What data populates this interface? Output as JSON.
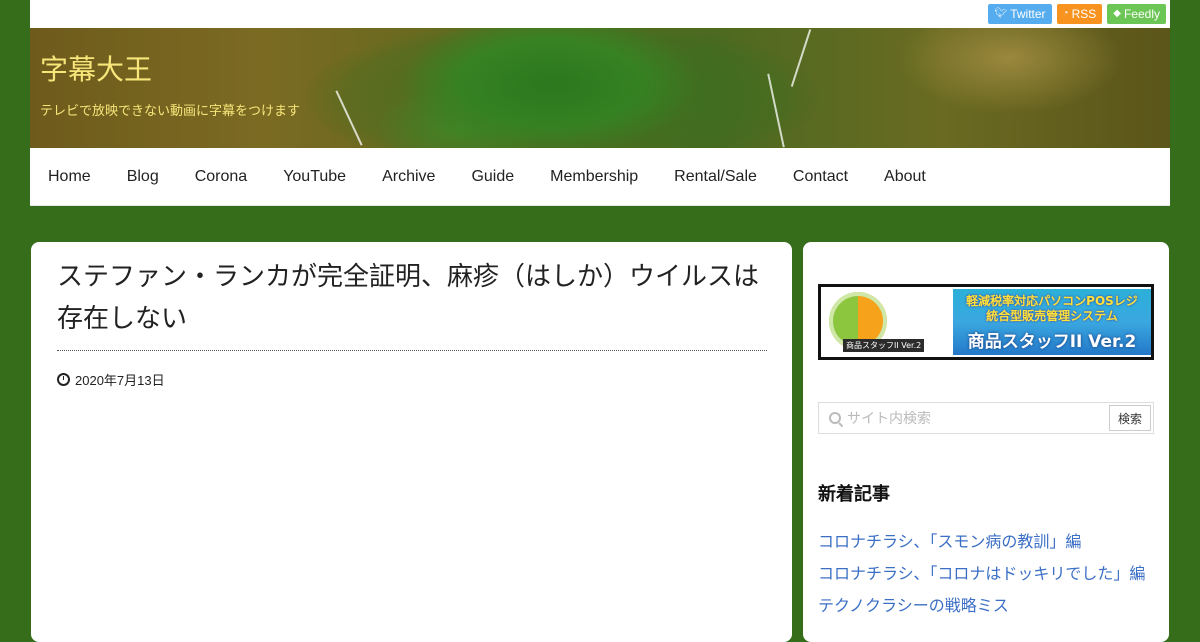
{
  "social": {
    "twitter_label": "Twitter",
    "rss_label": "RSS",
    "feedly_label": "Feedly",
    "twitter_color": "#55acee",
    "rss_color": "#f7931e",
    "feedly_color": "#6cc655"
  },
  "header": {
    "site_title": "字幕大王",
    "site_description": "テレビで放映できない動画に字幕をつけます",
    "title_color": "#f7e67a"
  },
  "nav": {
    "items": [
      {
        "label": "Home"
      },
      {
        "label": "Blog"
      },
      {
        "label": "Corona"
      },
      {
        "label": "YouTube"
      },
      {
        "label": "Archive"
      },
      {
        "label": "Guide"
      },
      {
        "label": "Membership"
      },
      {
        "label": "Rental/Sale"
      },
      {
        "label": "Contact"
      },
      {
        "label": "About"
      }
    ]
  },
  "article": {
    "title": "ステファン・ランカが完全証明、麻疹（はしか）ウイルスは存在しない",
    "date": "2020年7月13日"
  },
  "sidebar": {
    "banner": {
      "line1": "軽減税率対応パソコンPOSレジ",
      "line2": "統合型販売管理システム",
      "line3": "商品スタッフII Ver.2",
      "caption": "商品スタッフII Ver.2"
    },
    "search": {
      "placeholder": "サイト内検索",
      "value": "",
      "button_label": "検索"
    },
    "recent_title": "新着記事",
    "recent_posts": [
      {
        "label": "コロナチラシ、「スモン病の教訓」編"
      },
      {
        "label": "コロナチラシ、「コロナはドッキリでした」編"
      },
      {
        "label": "テクノクラシーの戦略ミス"
      }
    ]
  },
  "colors": {
    "page_background": "#356d1a",
    "link_color": "#3b6fc6"
  }
}
